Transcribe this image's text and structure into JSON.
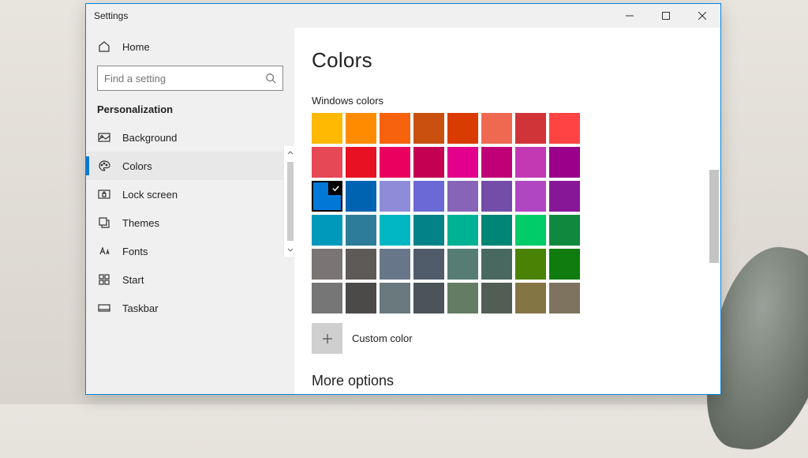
{
  "window": {
    "title": "Settings"
  },
  "sidebar": {
    "home": "Home",
    "search_placeholder": "Find a setting",
    "section": "Personalization",
    "items": [
      {
        "label": "Background",
        "icon": "picture-icon",
        "active": false
      },
      {
        "label": "Colors",
        "icon": "palette-icon",
        "active": true
      },
      {
        "label": "Lock screen",
        "icon": "lockscreen-icon",
        "active": false
      },
      {
        "label": "Themes",
        "icon": "themes-icon",
        "active": false
      },
      {
        "label": "Fonts",
        "icon": "fonts-icon",
        "active": false
      },
      {
        "label": "Start",
        "icon": "start-icon",
        "active": false
      },
      {
        "label": "Taskbar",
        "icon": "taskbar-icon",
        "active": false
      }
    ]
  },
  "main": {
    "title": "Colors",
    "windows_colors_label": "Windows colors",
    "custom_color_label": "Custom color",
    "more_options_label": "More options",
    "selected_index": 16,
    "swatches": [
      "#ffb900",
      "#ff8c00",
      "#f7630c",
      "#ca5010",
      "#da3b01",
      "#ef6950",
      "#d13438",
      "#ff4343",
      "#e74856",
      "#e81123",
      "#ea005e",
      "#c30052",
      "#e3008c",
      "#bf0077",
      "#c239b3",
      "#9a0089",
      "#0078d7",
      "#0063b1",
      "#8e8cd8",
      "#6b69d6",
      "#8764b8",
      "#744da9",
      "#b146c2",
      "#881798",
      "#0099bc",
      "#2d7d9a",
      "#00b7c3",
      "#038387",
      "#00b294",
      "#018574",
      "#00cc6a",
      "#10893e",
      "#7a7574",
      "#5d5a58",
      "#68768a",
      "#515c6b",
      "#567c73",
      "#486860",
      "#498205",
      "#107c10",
      "#767676",
      "#4c4a48",
      "#69797e",
      "#4a5459",
      "#647c64",
      "#525e54",
      "#847545",
      "#7e735f"
    ]
  }
}
